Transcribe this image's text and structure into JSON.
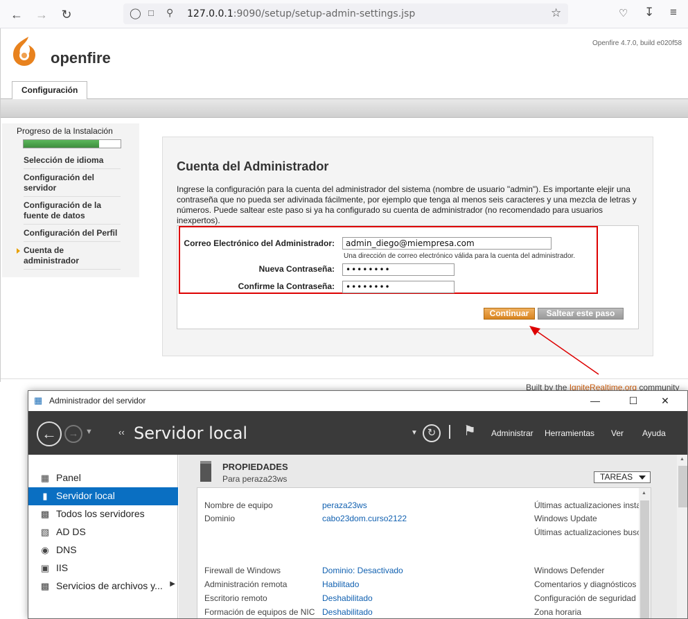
{
  "browser": {
    "url_host": "127.0.0.1",
    "url_path": ":9090/setup/setup-admin-settings.jsp",
    "back_icon": "arrow-left-icon",
    "forward_icon": "arrow-right-icon",
    "reload_icon": "reload-icon"
  },
  "openfire": {
    "logo_text": "openfire",
    "version": "Openfire 4.7.0, build e020f58",
    "tab_label": "Configuración",
    "sidebar": {
      "progress_label": "Progreso de la Instalación",
      "progress": 0.78,
      "items": [
        {
          "label": "Selección de idioma"
        },
        {
          "label": "Configuración del servidor"
        },
        {
          "label": "Configuración de la fuente de datos"
        },
        {
          "label": "Configuración del Perfil"
        },
        {
          "label": "Cuenta de administrador"
        }
      ]
    },
    "heading": "Cuenta del Administrador",
    "description": "Ingrese la configuración para la cuenta del administrador del sistema (nombre de usuario \"admin\"). Es importante elejir una contraseña que no pueda ser adivinada fácilmente, por ejemplo que tenga al menos seis caracteres y una mezcla de letras y números. Puede saltear este paso si ya ha configurado su cuenta de administrador (no recomendado para usuarios inexpertos).",
    "form": {
      "email_label": "Correo Electrónico del Administrador:",
      "email_value": "admin_diego@miempresa.com",
      "email_hint": "Una dirección de correo electrónico válida para la cuenta del administrador.",
      "password_label": "Nueva Contraseña:",
      "password_value": "••••••••",
      "confirm_label": "Confirme la Contraseña:",
      "confirm_value": "••••••••",
      "continue_label": "Continuar",
      "skip_label": "Saltear este paso"
    },
    "footer_prefix": "Built by the ",
    "footer_link": "IgniteRealtime.org",
    "footer_suffix": " community"
  },
  "server_manager": {
    "window_title": "Administrador del servidor",
    "page_title": "Servidor local",
    "menus": [
      "Administrar",
      "Herramientas",
      "Ver",
      "Ayuda"
    ],
    "nav": [
      {
        "label": "Panel",
        "icon": "dashboard-icon"
      },
      {
        "label": "Servidor local",
        "icon": "server-icon"
      },
      {
        "label": "Todos los servidores",
        "icon": "servers-icon"
      },
      {
        "label": "AD DS",
        "icon": "ad-ds-icon"
      },
      {
        "label": "DNS",
        "icon": "dns-icon"
      },
      {
        "label": "IIS",
        "icon": "iis-icon"
      },
      {
        "label": "Servicios de archivos y...",
        "icon": "file-services-icon"
      }
    ],
    "properties": {
      "title": "PROPIEDADES",
      "subtitle": "Para peraza23ws",
      "tasks_label": "TAREAS",
      "rows": [
        {
          "label": "Nombre de equipo",
          "value": "peraza23ws"
        },
        {
          "label": "Dominio",
          "value": "cabo23dom.curso2122"
        },
        {
          "label": "Firewall de Windows",
          "value": "Dominio: Desactivado"
        },
        {
          "label": "Administración remota",
          "value": "Habilitado"
        },
        {
          "label": "Escritorio remoto",
          "value": "Deshabilitado"
        },
        {
          "label": "Formación de equipos de NIC",
          "value": "Deshabilitado"
        }
      ],
      "right_labels": [
        "Últimas actualizaciones instaladas",
        "Windows Update",
        "Últimas actualizaciones buscadas",
        "Windows Defender",
        "Comentarios y diagnósticos",
        "Configuración de seguridad",
        "Zona horaria"
      ]
    }
  },
  "colors": {
    "accent_red": "#dd0000",
    "openfire_orange": "#e08a1e",
    "nav_selected": "#0a6fc2",
    "link_blue": "#1060b0"
  }
}
